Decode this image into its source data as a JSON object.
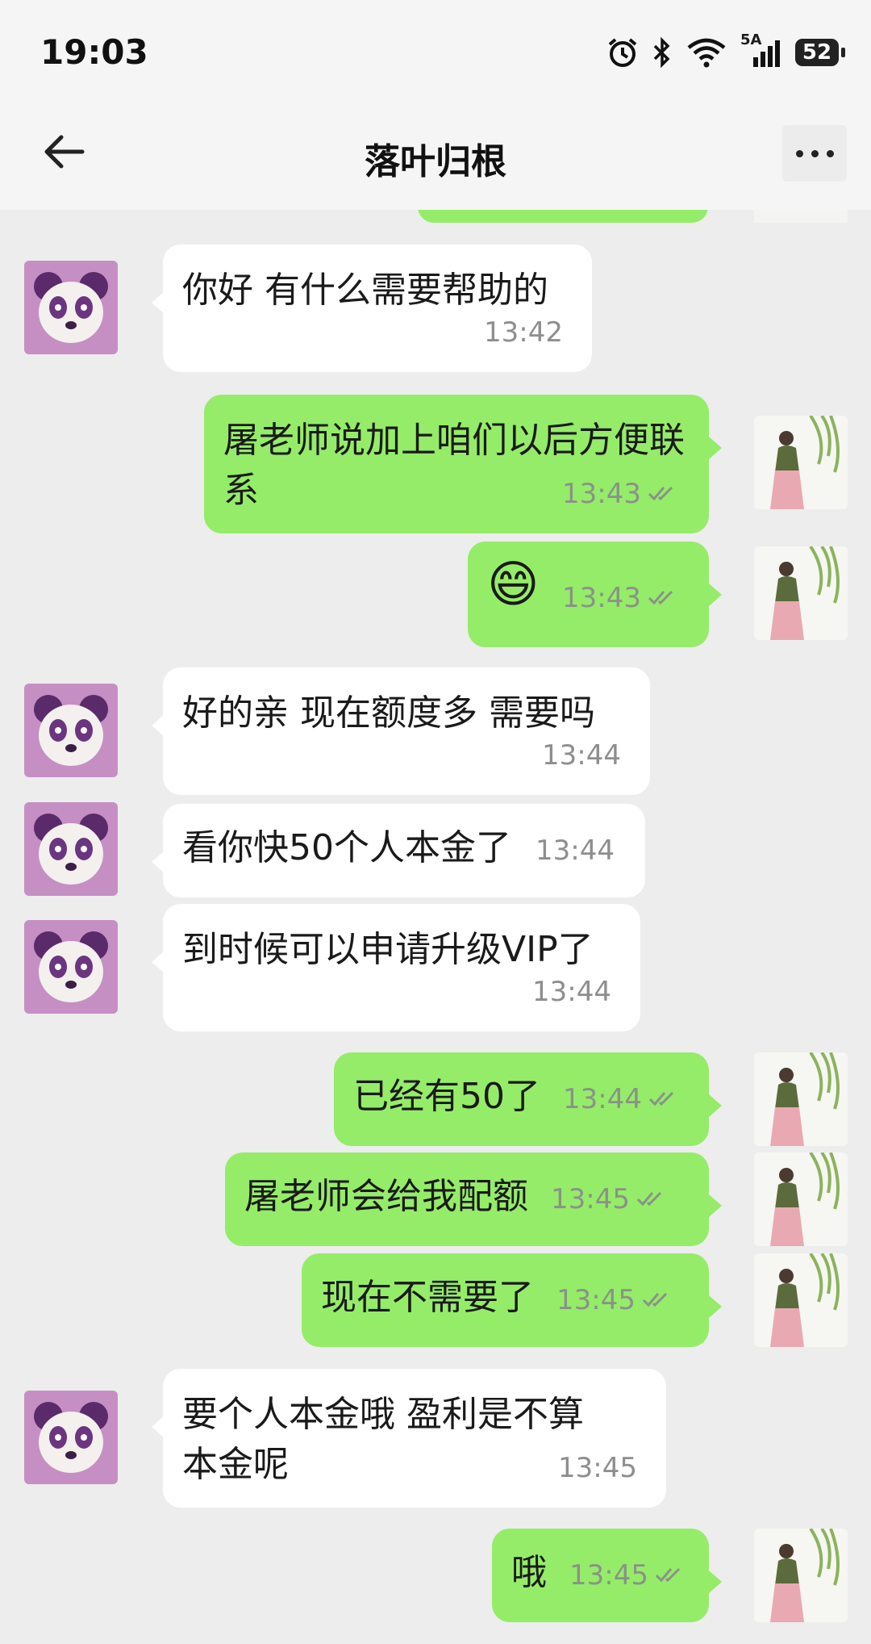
{
  "status_bar": {
    "time": "19:03",
    "network_label": "5A",
    "battery": "52"
  },
  "header": {
    "title": "落叶归根"
  },
  "messages": [
    {
      "side": "in",
      "text": "你好 有什么需要帮助的",
      "time": "13:42"
    },
    {
      "side": "out",
      "text": "屠老师说加上咱们以后方便联系",
      "time": "13:43"
    },
    {
      "side": "out",
      "text": "😄",
      "time": "13:43"
    },
    {
      "side": "in",
      "text": "好的亲  现在额度多 需要吗",
      "time": "13:44"
    },
    {
      "side": "in",
      "text": "看你快50个人本金了",
      "time": "13:44"
    },
    {
      "side": "in",
      "text": "到时候可以申请升级VIP了",
      "time": "13:44"
    },
    {
      "side": "out",
      "text": "已经有50了",
      "time": "13:44"
    },
    {
      "side": "out",
      "text": "屠老师会给我配额",
      "time": "13:45"
    },
    {
      "side": "out",
      "text": "现在不需要了",
      "time": "13:45"
    },
    {
      "side": "in",
      "text": "要个人本金哦 盈利是不算本金呢",
      "time": "13:45"
    },
    {
      "side": "out",
      "text": "哦",
      "time": "13:45"
    }
  ],
  "colors": {
    "outgoing_bubble": "#95ec69",
    "incoming_bubble": "#ffffff",
    "background": "#ededed"
  },
  "icons": {
    "back": "arrow-left-icon",
    "more": "more-dots-icon"
  }
}
